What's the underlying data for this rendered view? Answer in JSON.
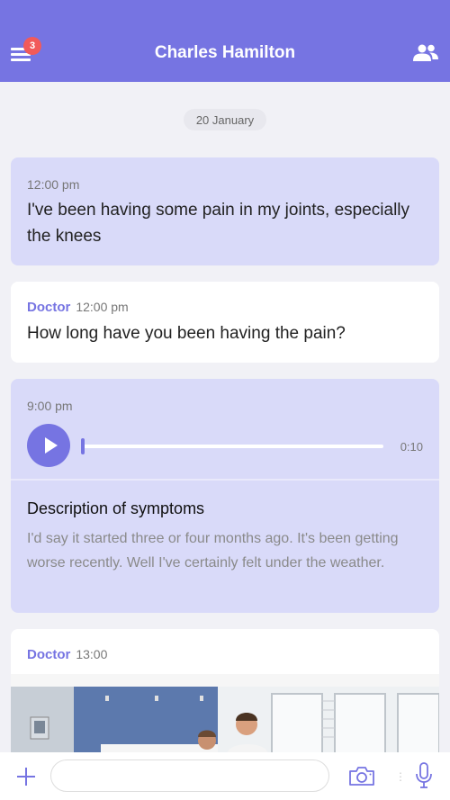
{
  "header": {
    "title": "Charles Hamilton",
    "menu_badge": "3",
    "menu_icon": "hamburger-icon",
    "people_icon": "people-icon",
    "color": "#7674e2"
  },
  "date_separator": "20 January",
  "messages": [
    {
      "time": "12:00 pm",
      "text": "I've been having some pain in my joints, especially the knees"
    },
    {
      "sender": "Doctor",
      "time": "12:00 pm",
      "text": "How long have you been having the pain?"
    },
    {
      "time": "9:00 pm",
      "audio_duration": "0:10",
      "audio_progress": 0.0,
      "description_title": "Description of symptoms",
      "description_text": "I'd say it started three or four months ago. It's been getting worse recently. Well I've certainly felt under the weather."
    },
    {
      "sender": "Doctor",
      "time": "13:00",
      "image": "photo-doctor-patient-bedroom"
    }
  ],
  "composer": {
    "placeholder": "",
    "add_icon": "plus-icon",
    "camera_icon": "camera-icon",
    "mic_icon": "microphone-icon"
  }
}
